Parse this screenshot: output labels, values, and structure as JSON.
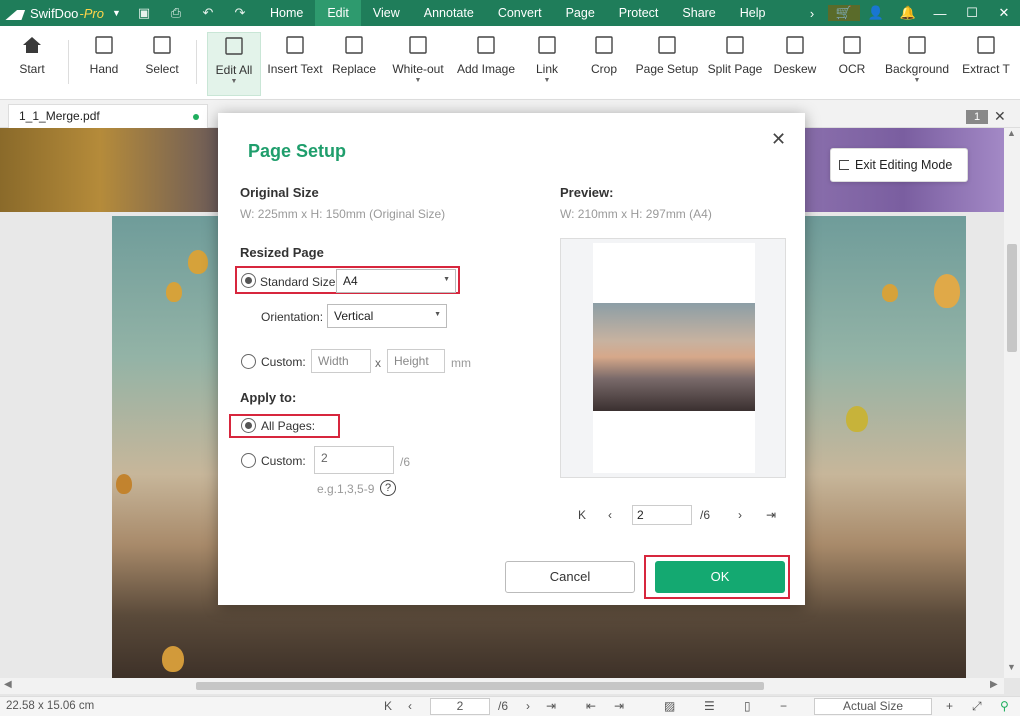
{
  "app": {
    "name": "SwifDoo",
    "suffix": "-Pro"
  },
  "menus": [
    "Home",
    "Edit",
    "View",
    "Annotate",
    "Convert",
    "Page",
    "Protect",
    "Share",
    "Help"
  ],
  "active_menu": "Edit",
  "ribbon": [
    {
      "label": "Start",
      "icon": "home-icon"
    },
    {
      "label": "Hand",
      "icon": "hand-icon"
    },
    {
      "label": "Select",
      "icon": "cursor-icon"
    },
    {
      "label": "Edit All",
      "icon": "edit-all-icon"
    },
    {
      "label": "Insert Text",
      "icon": "insert-text-icon"
    },
    {
      "label": "Replace",
      "icon": "replace-icon"
    },
    {
      "label": "White-out",
      "icon": "whiteout-icon"
    },
    {
      "label": "Add Image",
      "icon": "image-icon"
    },
    {
      "label": "Link",
      "icon": "link-icon"
    },
    {
      "label": "Crop",
      "icon": "crop-icon"
    },
    {
      "label": "Page Setup",
      "icon": "page-setup-icon"
    },
    {
      "label": "Split Page",
      "icon": "split-page-icon"
    },
    {
      "label": "Deskew",
      "icon": "deskew-icon"
    },
    {
      "label": "OCR",
      "icon": "ocr-icon"
    },
    {
      "label": "Background",
      "icon": "background-icon"
    },
    {
      "label": "Extract T",
      "icon": "extract-icon"
    }
  ],
  "tab": {
    "filename": "1_1_Merge.pdf",
    "page_badge": "1"
  },
  "exit_editing": "Exit Editing Mode",
  "dialog": {
    "title": "Page Setup",
    "original_size": {
      "heading": "Original Size",
      "value": "W: 225mm x H: 150mm (Original Size)"
    },
    "preview": {
      "heading": "Preview:",
      "value": "W: 210mm x H: 297mm (A4)",
      "page": "2",
      "total": "/6"
    },
    "resized": {
      "heading": "Resized Page",
      "standard_label": "Standard Size:",
      "standard_value": "A4",
      "orientation_label": "Orientation:",
      "orientation_value": "Vertical",
      "custom_label": "Custom:",
      "width_placeholder": "Width",
      "x": "x",
      "height_placeholder": "Height",
      "unit": "mm"
    },
    "apply": {
      "heading": "Apply to:",
      "all_label": "All Pages:",
      "custom_label": "Custom:",
      "custom_value": "2",
      "total": "/6",
      "hint": "e.g.1,3,5-9"
    },
    "buttons": {
      "cancel": "Cancel",
      "ok": "OK"
    }
  },
  "status": {
    "dimensions": "22.58 x 15.06 cm",
    "page": "2",
    "total": "/6",
    "zoom": "Actual Size"
  }
}
